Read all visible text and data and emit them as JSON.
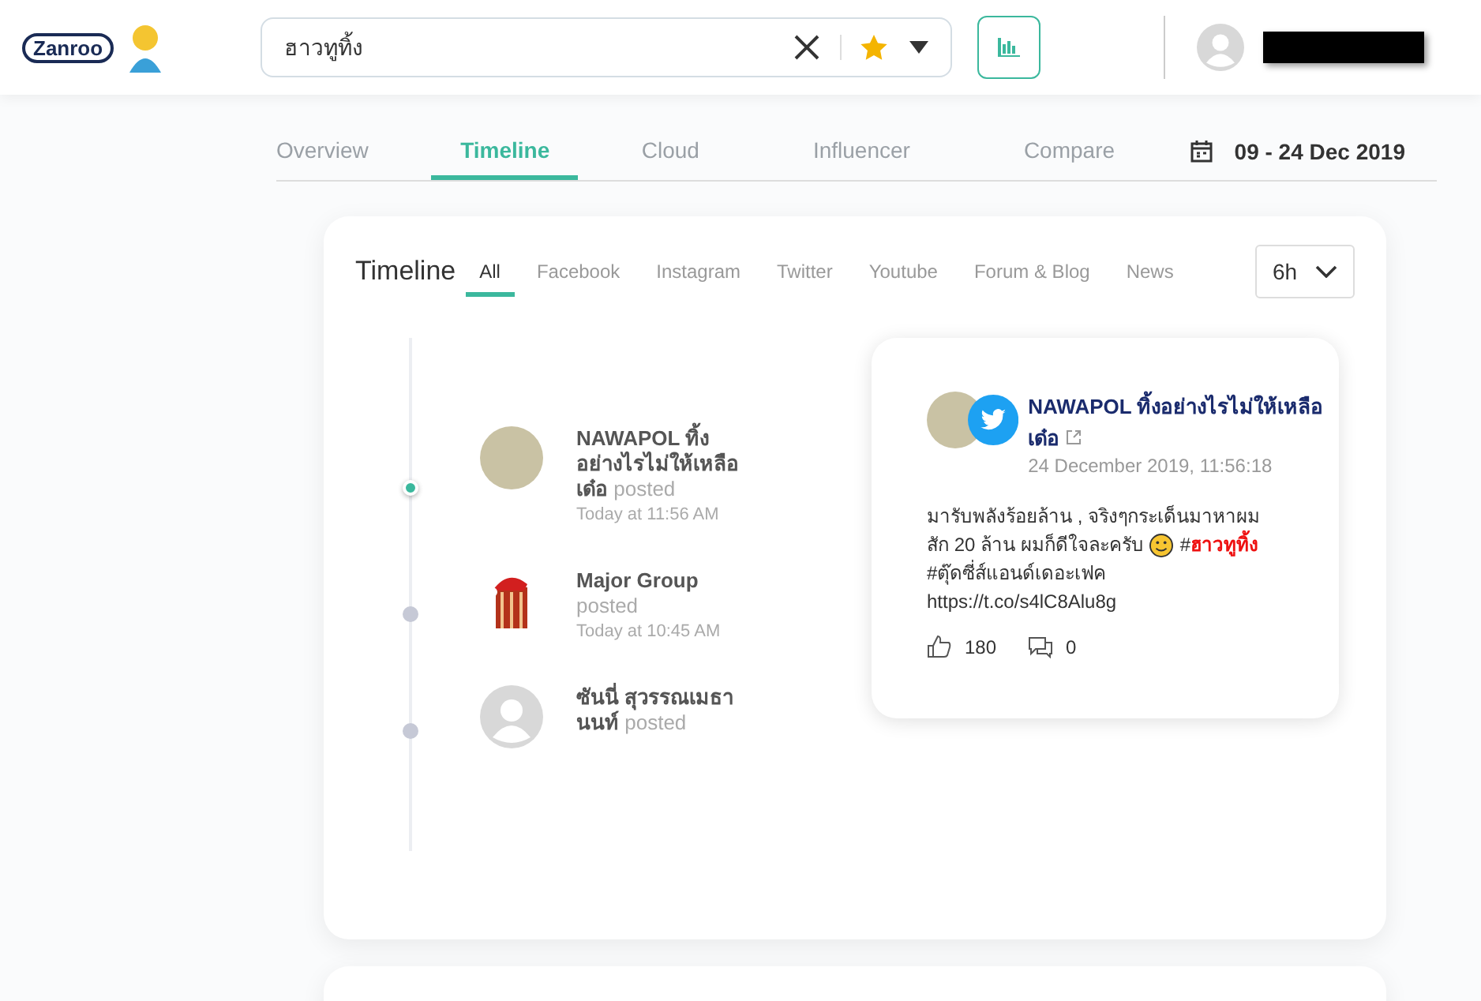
{
  "header": {
    "logo": "Zanroo",
    "search": {
      "value": "ฮาวทูทิ้ง"
    }
  },
  "tabs": [
    {
      "label": "Overview",
      "selected": false
    },
    {
      "label": "Timeline",
      "selected": true
    },
    {
      "label": "Cloud",
      "selected": false
    },
    {
      "label": "Influencer",
      "selected": false
    },
    {
      "label": "Compare",
      "selected": false
    }
  ],
  "date_range": "09 - 24 Dec 2019",
  "timeline": {
    "title": "Timeline",
    "filters": [
      {
        "label": "All",
        "selected": true
      },
      {
        "label": "Facebook",
        "selected": false
      },
      {
        "label": "Instagram",
        "selected": false
      },
      {
        "label": "Twitter",
        "selected": false
      },
      {
        "label": "Youtube",
        "selected": false
      },
      {
        "label": "Forum & Blog",
        "selected": false
      },
      {
        "label": "News",
        "selected": false
      }
    ],
    "interval": "6h",
    "items": [
      {
        "kind": "photo",
        "name": "NAWAPOL ทิ้งอย่างไรไม่ให้เหลือเด๋อ",
        "action": "posted",
        "time": "Today at 11:56 AM",
        "selected": true
      },
      {
        "kind": "logo",
        "name": "Major Group",
        "action": "posted",
        "time": "Today at 10:45 AM",
        "selected": false
      },
      {
        "kind": "silhouette",
        "name": "ซันนี่ สุวรรณเมธานนท์",
        "action": "posted",
        "selected": false
      }
    ],
    "post": {
      "author": "NAWAPOL ทิ้งอย่างไรไม่ให้เหลือเด๋อ",
      "date": "24 December 2019, 11:56:18",
      "text_lines": [
        "มารับพลังร้อยล้าน , จริงๆกระเด็นมาหาผม",
        "สัก 20 ล้าน ผมก็ดีใจละครับ"
      ],
      "tags": [
        "#**ฮาวทูทิ้ง**",
        "#ตุ๊ดซี่ส์แอนด์เดอะเฟค"
      ],
      "link": "https://t.co/s4lC8Alu8g",
      "likes": "180",
      "comments": "0"
    }
  }
}
